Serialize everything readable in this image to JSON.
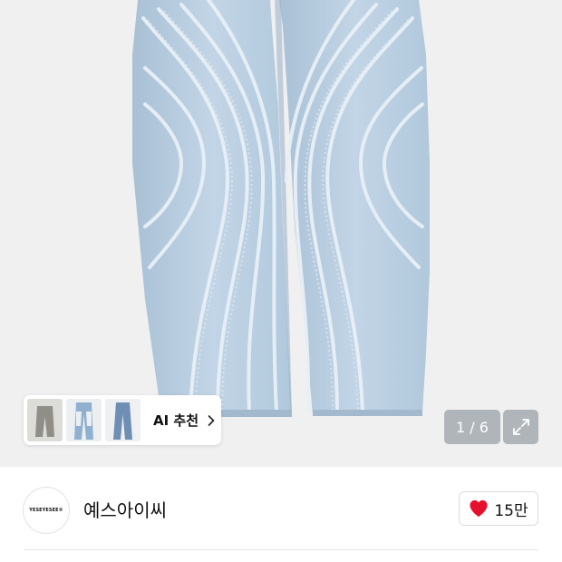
{
  "gallery": {
    "image_alt": "light blue wavy frayed-stripe jeans",
    "counter": "1 / 6",
    "current": 1,
    "total": 6,
    "expand_icon": "expand-icon"
  },
  "ai_recommend": {
    "label": "AI 추천",
    "chevron_icon": "chevron-right-icon",
    "thumbnails": [
      {
        "icon": "jeans-thumbnail-gray"
      },
      {
        "icon": "jeans-thumbnail-blue-cutout"
      },
      {
        "icon": "jeans-thumbnail-blue"
      }
    ]
  },
  "brand": {
    "logo_text": "YESEYESEE®",
    "name": "예스아이씨"
  },
  "like": {
    "icon": "heart-icon",
    "count": "15만",
    "color": "#e8112d"
  },
  "colors": {
    "gallery_bg": "#f0f0f1",
    "overlay_bg": "#a5aab0",
    "denim": "#b7cde0"
  }
}
